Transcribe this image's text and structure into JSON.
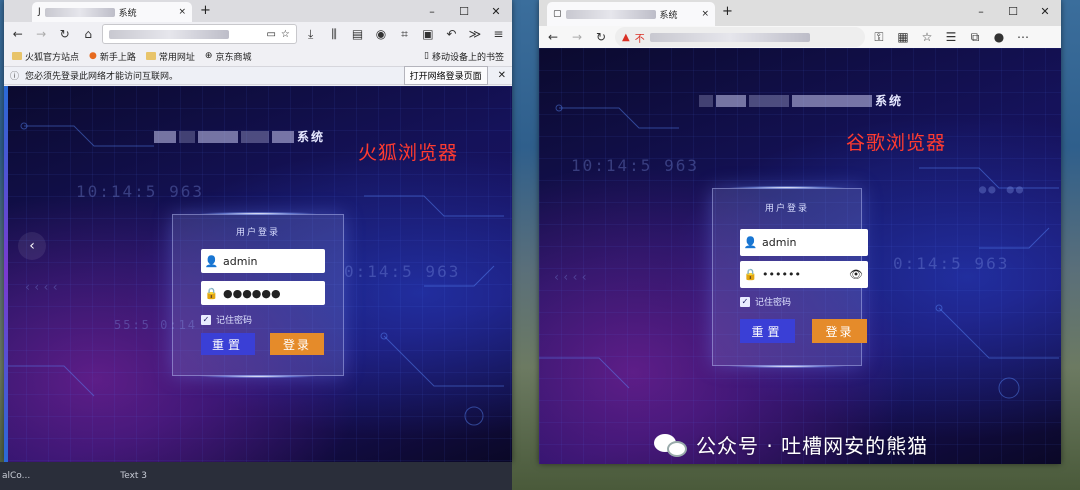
{
  "firefox": {
    "tab": {
      "title_prefix": "J",
      "title_suffix": "系统",
      "close": "×",
      "new_tab": "+"
    },
    "window_controls": [
      "–",
      "☐",
      "✕"
    ],
    "nav": {
      "more": "≫"
    },
    "bookmarks": [
      "火狐官方站点",
      "新手上路",
      "常用网址",
      "京东商城",
      "移动设备上的书签"
    ],
    "notice": {
      "text": "您必须先登录此网络才能访问互联网。",
      "button": "打开网络登录页面",
      "close": "✕"
    },
    "page": {
      "system_suffix": "系统",
      "deco_digits_1": "10:14:5 963",
      "deco_digits_2": "0:14:5 963",
      "deco_digits_3": "55:5 0:14",
      "login_title": "用户登录",
      "username": "admin",
      "password_mask": "●●●●●●",
      "remember": "记住密码",
      "reset_btn": "重置",
      "login_btn": "登录"
    }
  },
  "firefox_label": "火狐浏览器",
  "chrome": {
    "tab": {
      "title_suffix": "系统",
      "close": "×",
      "new_tab": "+"
    },
    "window_controls": [
      "–",
      "☐",
      "✕"
    ],
    "address": {
      "warning": "不",
      "icon": "▲"
    },
    "page": {
      "system_suffix": "系统",
      "deco_digits_1": "10:14:5 963",
      "deco_digits_2": "0:14:5 963",
      "login_title": "用户登录",
      "username": "admin",
      "password_mask": "••••••",
      "remember": "记住密码",
      "reset_btn": "重置",
      "login_btn": "登录"
    }
  },
  "chrome_label": "谷歌浏览器",
  "taskbar": {
    "item1": "alCo...",
    "item2": "Text 3"
  },
  "watermark": "公众号 · 吐槽网安的熊猫",
  "colors": {
    "annotation": "#ff3b30",
    "reset": "#3a3fd6",
    "login": "#e58b2a"
  }
}
